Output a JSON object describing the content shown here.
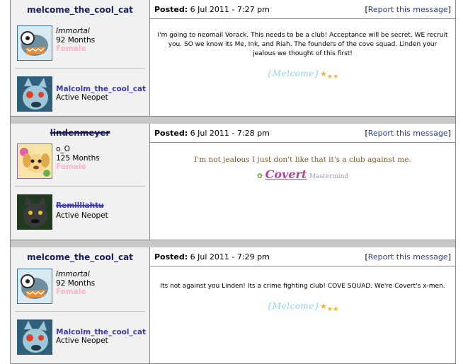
{
  "posts": [
    {
      "username": "melcome_the_cool_cat",
      "title": "Immortal",
      "months": "92 Months",
      "gender": "Female",
      "pet_name": "Malcolm_the_cool_cat",
      "pet_status": "Active Neopet",
      "posted_label": "Posted:",
      "posted_date": "6 Jul 2011 - 7:27 pm",
      "report_label": "Report this message",
      "message": "I'm going to neomail Vorack. This needs to be a club! Acceptance will be secret. WE recruit you. SO we know its Me, Ink, and Riah. The founders of the cove squad. Linden your jealous we thought of this first!",
      "signature": "{Melcome}"
    },
    {
      "username": "lindenmeyer",
      "title": "o_O",
      "months": "125 Months",
      "gender": "Female",
      "pet_name": "Remilliahtu",
      "pet_status": "Active Neopet",
      "posted_label": "Posted:",
      "posted_date": "6 Jul 2011 - 7:28 pm",
      "report_label": "Report this message",
      "message": "I'm not jealous I just don't like that it's a club against me.",
      "signature": "Covert",
      "signature_sub": "Mastermind"
    },
    {
      "username": "melcome_the_cool_cat",
      "title": "Immortal",
      "months": "92 Months",
      "gender": "Female",
      "pet_name": "Malcolm_the_cool_cat",
      "pet_status": "Active Neopet",
      "posted_label": "Posted:",
      "posted_date": "6 Jul 2011 - 7:29 pm",
      "report_label": "Report this message",
      "message": "Its not against you Linden! Its a crime fighting club! COVE SQUAD. We're Covert's x-men.",
      "signature": "{Melcome}"
    }
  ],
  "icons": {
    "user_avatar": "shark-avatar-icon",
    "pet_avatar": "wolf-pet-icon",
    "stars": "star-sparkle-icon",
    "flower": "flower-icon"
  },
  "colors": {
    "username": "#1a1e5c",
    "link": "#2c3c9e",
    "pet_link": "#3a3ab8",
    "gender": "#ffb3c8",
    "separator": "#c8c8c8",
    "sidebar": "#f1f1f1"
  }
}
